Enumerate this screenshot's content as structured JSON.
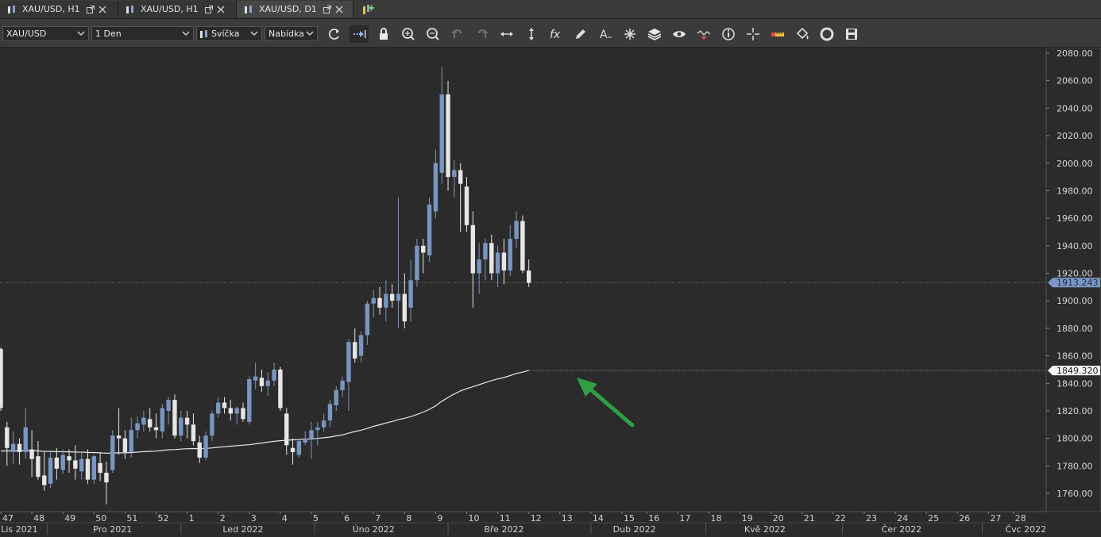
{
  "tabs": [
    {
      "label": "XAU/USD, H1",
      "active": false
    },
    {
      "label": "XAU/USD, H1",
      "active": false
    },
    {
      "label": "XAU/USD, D1",
      "active": true
    }
  ],
  "toolbar": {
    "symbol": "XAU/USD",
    "timeframe": "1 Den",
    "chart_type": "Svíčka",
    "price_side": "Nabídka",
    "icons": [
      "refresh-icon",
      "autoscroll-icon",
      "lock-icon",
      "zoom-in-icon",
      "zoom-out-icon",
      "undo-icon",
      "redo-icon",
      "horizontal-resize-icon",
      "vertical-resize-icon",
      "indicators-fx-icon",
      "pencil-icon",
      "text-tool-icon",
      "pattern-star-icon",
      "layers-icon",
      "eye-icon",
      "chart-signal-icon",
      "info-icon",
      "crosshair-icon",
      "ruler-icon",
      "paint-bucket-icon",
      "lifebuoy-icon",
      "save-icon"
    ]
  },
  "colors": {
    "background": "#2b2b2b",
    "bull": "#7a95c0",
    "bear": "#e6e6e6",
    "ma_line": "#e8e8e8",
    "arrow": "#2ea043"
  },
  "chart_data": {
    "type": "candlestick",
    "symbol": "XAU/USD",
    "timeframe": "D1",
    "ylim": [
      1750,
      2085
    ],
    "y_ticks": [
      "2080.00",
      "2060.00",
      "2040.00",
      "2020.00",
      "2000.00",
      "1980.00",
      "1960.00",
      "1940.00",
      "1920.00",
      "1900.00",
      "1880.00",
      "1860.00",
      "1840.00",
      "1820.00",
      "1800.00",
      "1780.00",
      "1760.00"
    ],
    "current_price": {
      "label": "1913.243",
      "value": 1913.243
    },
    "ma_price": {
      "label": "1849.320",
      "value": 1849.32
    },
    "week_ticks": [
      {
        "label": "47",
        "i": 0
      },
      {
        "label": "48",
        "i": 5
      },
      {
        "label": "49",
        "i": 10
      },
      {
        "label": "50",
        "i": 15
      },
      {
        "label": "51",
        "i": 20
      },
      {
        "label": "52",
        "i": 25
      },
      {
        "label": "1",
        "i": 30
      },
      {
        "label": "2",
        "i": 35
      },
      {
        "label": "3",
        "i": 40
      },
      {
        "label": "4",
        "i": 45
      },
      {
        "label": "5",
        "i": 50
      },
      {
        "label": "6",
        "i": 55
      },
      {
        "label": "7",
        "i": 60
      },
      {
        "label": "8",
        "i": 65
      },
      {
        "label": "9",
        "i": 70
      },
      {
        "label": "10",
        "i": 75
      },
      {
        "label": "11",
        "i": 80
      },
      {
        "label": "12",
        "i": 85
      },
      {
        "label": "13",
        "i": 90
      },
      {
        "label": "14",
        "i": 95
      },
      {
        "label": "15",
        "i": 100
      },
      {
        "label": "16",
        "i": 104
      },
      {
        "label": "17",
        "i": 109
      },
      {
        "label": "18",
        "i": 114
      },
      {
        "label": "19",
        "i": 119
      },
      {
        "label": "20",
        "i": 124
      },
      {
        "label": "21",
        "i": 129
      },
      {
        "label": "22",
        "i": 134
      },
      {
        "label": "23",
        "i": 139
      },
      {
        "label": "24",
        "i": 144
      },
      {
        "label": "25",
        "i": 149
      },
      {
        "label": "26",
        "i": 154
      },
      {
        "label": "27",
        "i": 159
      },
      {
        "label": "28",
        "i": 163
      }
    ],
    "month_ticks": [
      {
        "label": "Lis 2021",
        "i": 3
      },
      {
        "label": "Pro 2021",
        "i": 18
      },
      {
        "label": "Led 2022",
        "i": 39
      },
      {
        "label": "Úno 2022",
        "i": 60
      },
      {
        "label": "Bře 2022",
        "i": 81
      },
      {
        "label": "Dub 2022",
        "i": 102
      },
      {
        "label": "Kvě 2022",
        "i": 123
      },
      {
        "label": "Čer 2022",
        "i": 145
      },
      {
        "label": "Čvc 2022",
        "i": 165
      }
    ],
    "candles": [
      {
        "o": 1865,
        "h": 1866,
        "l": 1820,
        "c": 1822
      },
      {
        "o": 1808,
        "h": 1812,
        "l": 1780,
        "c": 1793
      },
      {
        "o": 1790,
        "h": 1805,
        "l": 1781,
        "c": 1796
      },
      {
        "o": 1796,
        "h": 1800,
        "l": 1781,
        "c": 1790
      },
      {
        "o": 1790,
        "h": 1822,
        "l": 1785,
        "c": 1808
      },
      {
        "o": 1792,
        "h": 1806,
        "l": 1772,
        "c": 1785
      },
      {
        "o": 1787,
        "h": 1798,
        "l": 1770,
        "c": 1772
      },
      {
        "o": 1773,
        "h": 1790,
        "l": 1762,
        "c": 1766
      },
      {
        "o": 1767,
        "h": 1790,
        "l": 1764,
        "c": 1786
      },
      {
        "o": 1786,
        "h": 1793,
        "l": 1770,
        "c": 1778
      },
      {
        "o": 1777,
        "h": 1792,
        "l": 1774,
        "c": 1788
      },
      {
        "o": 1787,
        "h": 1792,
        "l": 1775,
        "c": 1784
      },
      {
        "o": 1784,
        "h": 1795,
        "l": 1770,
        "c": 1778
      },
      {
        "o": 1776,
        "h": 1790,
        "l": 1770,
        "c": 1785
      },
      {
        "o": 1785,
        "h": 1792,
        "l": 1767,
        "c": 1770
      },
      {
        "o": 1770,
        "h": 1788,
        "l": 1767,
        "c": 1787
      },
      {
        "o": 1782,
        "h": 1790,
        "l": 1769,
        "c": 1775
      },
      {
        "o": 1775,
        "h": 1783,
        "l": 1752,
        "c": 1768
      },
      {
        "o": 1777,
        "h": 1806,
        "l": 1775,
        "c": 1802
      },
      {
        "o": 1802,
        "h": 1822,
        "l": 1788,
        "c": 1800
      },
      {
        "o": 1800,
        "h": 1806,
        "l": 1785,
        "c": 1790
      },
      {
        "o": 1790,
        "h": 1815,
        "l": 1786,
        "c": 1806
      },
      {
        "o": 1806,
        "h": 1816,
        "l": 1800,
        "c": 1811
      },
      {
        "o": 1810,
        "h": 1820,
        "l": 1805,
        "c": 1815
      },
      {
        "o": 1814,
        "h": 1822,
        "l": 1805,
        "c": 1808
      },
      {
        "o": 1808,
        "h": 1818,
        "l": 1800,
        "c": 1806
      },
      {
        "o": 1805,
        "h": 1825,
        "l": 1800,
        "c": 1822
      },
      {
        "o": 1820,
        "h": 1830,
        "l": 1810,
        "c": 1828
      },
      {
        "o": 1828,
        "h": 1832,
        "l": 1800,
        "c": 1802
      },
      {
        "o": 1802,
        "h": 1820,
        "l": 1798,
        "c": 1815
      },
      {
        "o": 1815,
        "h": 1820,
        "l": 1800,
        "c": 1810
      },
      {
        "o": 1810,
        "h": 1818,
        "l": 1795,
        "c": 1798
      },
      {
        "o": 1797,
        "h": 1802,
        "l": 1782,
        "c": 1786
      },
      {
        "o": 1786,
        "h": 1805,
        "l": 1784,
        "c": 1802
      },
      {
        "o": 1802,
        "h": 1820,
        "l": 1798,
        "c": 1818
      },
      {
        "o": 1818,
        "h": 1830,
        "l": 1815,
        "c": 1826
      },
      {
        "o": 1826,
        "h": 1830,
        "l": 1818,
        "c": 1822
      },
      {
        "o": 1822,
        "h": 1828,
        "l": 1813,
        "c": 1818
      },
      {
        "o": 1818,
        "h": 1823,
        "l": 1810,
        "c": 1822
      },
      {
        "o": 1822,
        "h": 1826,
        "l": 1812,
        "c": 1814
      },
      {
        "o": 1812,
        "h": 1845,
        "l": 1810,
        "c": 1843
      },
      {
        "o": 1842,
        "h": 1855,
        "l": 1836,
        "c": 1845
      },
      {
        "o": 1844,
        "h": 1850,
        "l": 1834,
        "c": 1838
      },
      {
        "o": 1838,
        "h": 1848,
        "l": 1831,
        "c": 1842
      },
      {
        "o": 1842,
        "h": 1855,
        "l": 1838,
        "c": 1850
      },
      {
        "o": 1850,
        "h": 1852,
        "l": 1820,
        "c": 1822
      },
      {
        "o": 1818,
        "h": 1822,
        "l": 1788,
        "c": 1795
      },
      {
        "o": 1793,
        "h": 1800,
        "l": 1781,
        "c": 1790
      },
      {
        "o": 1788,
        "h": 1800,
        "l": 1786,
        "c": 1798
      },
      {
        "o": 1797,
        "h": 1805,
        "l": 1795,
        "c": 1800
      },
      {
        "o": 1800,
        "h": 1812,
        "l": 1785,
        "c": 1806
      },
      {
        "o": 1806,
        "h": 1812,
        "l": 1795,
        "c": 1808
      },
      {
        "o": 1808,
        "h": 1818,
        "l": 1805,
        "c": 1813
      },
      {
        "o": 1813,
        "h": 1828,
        "l": 1808,
        "c": 1825
      },
      {
        "o": 1824,
        "h": 1838,
        "l": 1820,
        "c": 1835
      },
      {
        "o": 1835,
        "h": 1845,
        "l": 1830,
        "c": 1842
      },
      {
        "o": 1841,
        "h": 1872,
        "l": 1820,
        "c": 1870
      },
      {
        "o": 1870,
        "h": 1880,
        "l": 1855,
        "c": 1858
      },
      {
        "o": 1860,
        "h": 1878,
        "l": 1855,
        "c": 1875
      },
      {
        "o": 1875,
        "h": 1900,
        "l": 1868,
        "c": 1898
      },
      {
        "o": 1898,
        "h": 1908,
        "l": 1888,
        "c": 1902
      },
      {
        "o": 1902,
        "h": 1910,
        "l": 1890,
        "c": 1895
      },
      {
        "o": 1895,
        "h": 1915,
        "l": 1885,
        "c": 1905
      },
      {
        "o": 1905,
        "h": 1912,
        "l": 1895,
        "c": 1900
      },
      {
        "o": 1900,
        "h": 1975,
        "l": 1880,
        "c": 1905
      },
      {
        "o": 1905,
        "h": 1920,
        "l": 1880,
        "c": 1885
      },
      {
        "o": 1895,
        "h": 1930,
        "l": 1885,
        "c": 1915
      },
      {
        "o": 1915,
        "h": 1945,
        "l": 1910,
        "c": 1940
      },
      {
        "o": 1940,
        "h": 1945,
        "l": 1920,
        "c": 1935
      },
      {
        "o": 1933,
        "h": 1975,
        "l": 1928,
        "c": 1970
      },
      {
        "o": 1965,
        "h": 2010,
        "l": 1960,
        "c": 2000
      },
      {
        "o": 1993,
        "h": 2070,
        "l": 1985,
        "c": 2050
      },
      {
        "o": 2050,
        "h": 2060,
        "l": 1980,
        "c": 1990
      },
      {
        "o": 1990,
        "h": 2002,
        "l": 1975,
        "c": 1995
      },
      {
        "o": 1995,
        "h": 2000,
        "l": 1950,
        "c": 1985
      },
      {
        "o": 1983,
        "h": 1990,
        "l": 1950,
        "c": 1955
      },
      {
        "o": 1955,
        "h": 1965,
        "l": 1895,
        "c": 1920
      },
      {
        "o": 1920,
        "h": 1942,
        "l": 1905,
        "c": 1930
      },
      {
        "o": 1930,
        "h": 1945,
        "l": 1915,
        "c": 1942
      },
      {
        "o": 1942,
        "h": 1948,
        "l": 1915,
        "c": 1920
      },
      {
        "o": 1920,
        "h": 1940,
        "l": 1910,
        "c": 1935
      },
      {
        "o": 1935,
        "h": 1945,
        "l": 1912,
        "c": 1922
      },
      {
        "o": 1922,
        "h": 1955,
        "l": 1918,
        "c": 1945
      },
      {
        "o": 1945,
        "h": 1965,
        "l": 1938,
        "c": 1958
      },
      {
        "o": 1958,
        "h": 1962,
        "l": 1920,
        "c": 1922
      },
      {
        "o": 1922,
        "h": 1930,
        "l": 1910,
        "c": 1913
      }
    ]
  }
}
